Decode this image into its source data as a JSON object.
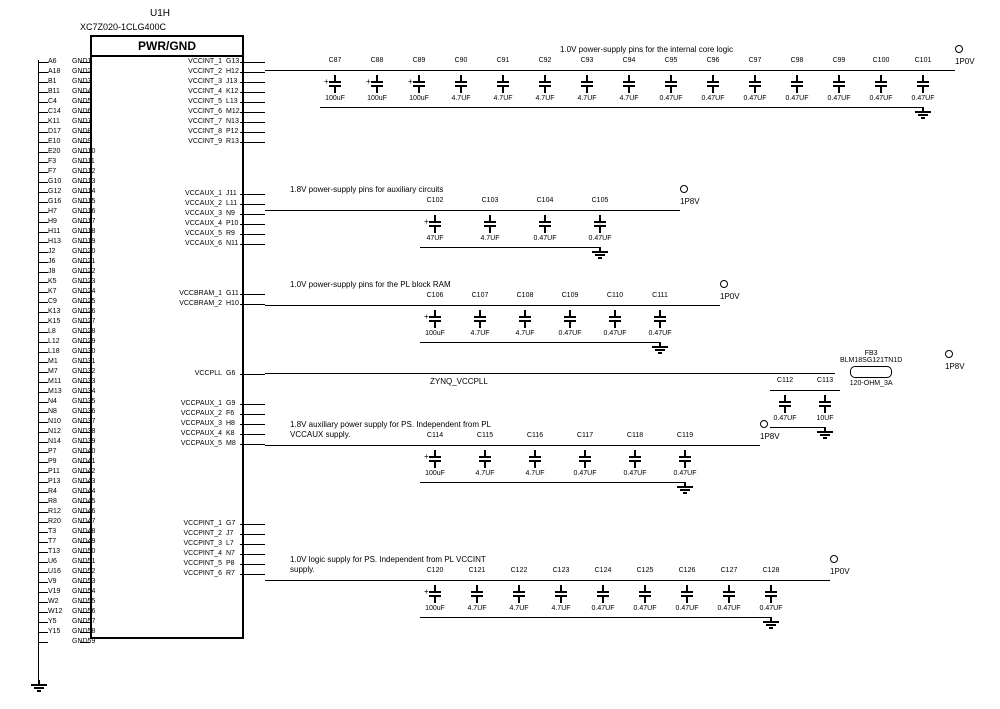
{
  "ref": "U1H",
  "part": "XC7Z020-1CLG400C",
  "block_title": "PWR/GND",
  "rails": {
    "vccint": "1P0V",
    "vccaux": "1P8V",
    "vccbram": "1P0V",
    "vccpaux": "1P8V",
    "vccpint": "1P0V",
    "vccpll": "1P8V"
  },
  "notes": {
    "vccint": "1.0V power-supply pins for the internal core logic",
    "vccaux": "1.8V power-supply pins for auxiliary circuits",
    "vccbram": "1.0V power-supply pins for the PL block RAM",
    "vccpaux1": "1.8V auxiliary power supply for PS. Independent from PL",
    "vccpaux2": "VCCAUX supply.",
    "vccpint1": "1.0V logic supply for PS. Independent from PL VCCINT",
    "vccpint2": "supply.",
    "vccpll_net": "ZYNQ_VCCPLL"
  },
  "ferrite": {
    "ref": "FB3",
    "part": "BLM18SG121TN1D",
    "value": "120-OHM_3A"
  },
  "pll_caps": [
    {
      "ref": "C112",
      "val": "0.47UF"
    },
    {
      "ref": "C113",
      "val": "10UF"
    }
  ],
  "left_pins": [
    {
      "num": "A6",
      "name": "GND1"
    },
    {
      "num": "A18",
      "name": "GND2"
    },
    {
      "num": "B1",
      "name": "GND3"
    },
    {
      "num": "B11",
      "name": "GND4"
    },
    {
      "num": "C4",
      "name": "GND5"
    },
    {
      "num": "C14",
      "name": "GND6"
    },
    {
      "num": "K11",
      "name": "GND7"
    },
    {
      "num": "D17",
      "name": "GND8"
    },
    {
      "num": "E10",
      "name": "GND9"
    },
    {
      "num": "E20",
      "name": "GND10"
    },
    {
      "num": "F3",
      "name": "GND11"
    },
    {
      "num": "F7",
      "name": "GND12"
    },
    {
      "num": "G10",
      "name": "GND13"
    },
    {
      "num": "G12",
      "name": "GND14"
    },
    {
      "num": "G16",
      "name": "GND15"
    },
    {
      "num": "H7",
      "name": "GND16"
    },
    {
      "num": "H9",
      "name": "GND17"
    },
    {
      "num": "H11",
      "name": "GND18"
    },
    {
      "num": "H13",
      "name": "GND19"
    },
    {
      "num": "J2",
      "name": "GND20"
    },
    {
      "num": "J6",
      "name": "GND21"
    },
    {
      "num": "J8",
      "name": "GND22"
    },
    {
      "num": "K5",
      "name": "GND23"
    },
    {
      "num": "K7",
      "name": "GND24"
    },
    {
      "num": "C9",
      "name": "GND25"
    },
    {
      "num": "K13",
      "name": "GND26"
    },
    {
      "num": "K15",
      "name": "GND27"
    },
    {
      "num": "L8",
      "name": "GND28"
    },
    {
      "num": "L12",
      "name": "GND29"
    },
    {
      "num": "L18",
      "name": "GND30"
    },
    {
      "num": "M1",
      "name": "GND31"
    },
    {
      "num": "M7",
      "name": "GND32"
    },
    {
      "num": "M11",
      "name": "GND33"
    },
    {
      "num": "M13",
      "name": "GND34"
    },
    {
      "num": "N4",
      "name": "GND35"
    },
    {
      "num": "N8",
      "name": "GND36"
    },
    {
      "num": "N10",
      "name": "GND37"
    },
    {
      "num": "N12",
      "name": "GND38"
    },
    {
      "num": "N14",
      "name": "GND39"
    },
    {
      "num": "P7",
      "name": "GND40"
    },
    {
      "num": "P9",
      "name": "GND41"
    },
    {
      "num": "P11",
      "name": "GND42"
    },
    {
      "num": "P13",
      "name": "GND43"
    },
    {
      "num": "R4",
      "name": "GND44"
    },
    {
      "num": "R8",
      "name": "GND45"
    },
    {
      "num": "R12",
      "name": "GND46"
    },
    {
      "num": "R20",
      "name": "GND47"
    },
    {
      "num": "T3",
      "name": "GND48"
    },
    {
      "num": "T7",
      "name": "GND49"
    },
    {
      "num": "T13",
      "name": "GND50"
    },
    {
      "num": "U6",
      "name": "GND51"
    },
    {
      "num": "U16",
      "name": "GND52"
    },
    {
      "num": "V9",
      "name": "GND53"
    },
    {
      "num": "V19",
      "name": "GND54"
    },
    {
      "num": "W2",
      "name": "GND55"
    },
    {
      "num": "W12",
      "name": "GND56"
    },
    {
      "num": "Y5",
      "name": "GND57"
    },
    {
      "num": "Y15",
      "name": "GND58"
    },
    {
      "num": "",
      "name": "GND59"
    }
  ],
  "right_groups": [
    {
      "key": "vccint",
      "pins": [
        {
          "name": "VCCINT_1",
          "num": "G13"
        },
        {
          "name": "VCCINT_2",
          "num": "H12"
        },
        {
          "name": "VCCINT_3",
          "num": "J13"
        },
        {
          "name": "VCCINT_4",
          "num": "K12"
        },
        {
          "name": "VCCINT_5",
          "num": "L13"
        },
        {
          "name": "VCCINT_6",
          "num": "M12"
        },
        {
          "name": "VCCINT_7",
          "num": "N13"
        },
        {
          "name": "VCCINT_8",
          "num": "P12"
        },
        {
          "name": "VCCINT_9",
          "num": "R13"
        }
      ]
    },
    {
      "key": "vccaux",
      "pins": [
        {
          "name": "VCCAUX_1",
          "num": "J11"
        },
        {
          "name": "VCCAUX_2",
          "num": "L11"
        },
        {
          "name": "VCCAUX_3",
          "num": "N9"
        },
        {
          "name": "VCCAUX_4",
          "num": "P10"
        },
        {
          "name": "VCCAUX_5",
          "num": "R9"
        },
        {
          "name": "VCCAUX_6",
          "num": "N11"
        }
      ]
    },
    {
      "key": "vccbram",
      "pins": [
        {
          "name": "VCCBRAM_1",
          "num": "G11"
        },
        {
          "name": "VCCBRAM_2",
          "num": "H10"
        }
      ]
    },
    {
      "key": "vccpll",
      "pins": [
        {
          "name": "VCCPLL",
          "num": "G6"
        }
      ]
    },
    {
      "key": "vccpaux",
      "pins": [
        {
          "name": "VCCPAUX_1",
          "num": "G9"
        },
        {
          "name": "VCCPAUX_2",
          "num": "F6"
        },
        {
          "name": "VCCPAUX_3",
          "num": "H8"
        },
        {
          "name": "VCCPAUX_4",
          "num": "K8"
        },
        {
          "name": "VCCPAUX_5",
          "num": "M8"
        }
      ]
    },
    {
      "key": "vccpint",
      "pins": [
        {
          "name": "VCCPINT_1",
          "num": "G7"
        },
        {
          "name": "VCCPINT_2",
          "num": "J7"
        },
        {
          "name": "VCCPINT_3",
          "num": "L7"
        },
        {
          "name": "VCCPINT_4",
          "num": "N7"
        },
        {
          "name": "VCCPINT_5",
          "num": "P8"
        },
        {
          "name": "VCCPINT_6",
          "num": "R7"
        }
      ]
    }
  ],
  "cap_banks": {
    "vccint": [
      {
        "ref": "C87",
        "val": "100uF",
        "pol": true
      },
      {
        "ref": "C88",
        "val": "100uF",
        "pol": true
      },
      {
        "ref": "C89",
        "val": "100uF",
        "pol": true
      },
      {
        "ref": "C90",
        "val": "4.7UF"
      },
      {
        "ref": "C91",
        "val": "4.7UF"
      },
      {
        "ref": "C92",
        "val": "4.7UF"
      },
      {
        "ref": "C93",
        "val": "4.7UF"
      },
      {
        "ref": "C94",
        "val": "4.7UF"
      },
      {
        "ref": "C95",
        "val": "0.47UF"
      },
      {
        "ref": "C96",
        "val": "0.47UF"
      },
      {
        "ref": "C97",
        "val": "0.47UF"
      },
      {
        "ref": "C98",
        "val": "0.47UF"
      },
      {
        "ref": "C99",
        "val": "0.47UF"
      },
      {
        "ref": "C100",
        "val": "0.47UF"
      },
      {
        "ref": "C101",
        "val": "0.47UF"
      }
    ],
    "vccaux": [
      {
        "ref": "C102",
        "val": "47UF",
        "pol": true
      },
      {
        "ref": "C103",
        "val": "4.7UF"
      },
      {
        "ref": "C104",
        "val": "0.47UF"
      },
      {
        "ref": "C105",
        "val": "0.47UF"
      }
    ],
    "vccbram": [
      {
        "ref": "C106",
        "val": "100uF",
        "pol": true
      },
      {
        "ref": "C107",
        "val": "4.7UF"
      },
      {
        "ref": "C108",
        "val": "4.7UF"
      },
      {
        "ref": "C109",
        "val": "0.47UF"
      },
      {
        "ref": "C110",
        "val": "0.47UF"
      },
      {
        "ref": "C111",
        "val": "0.47UF"
      }
    ],
    "vccpaux": [
      {
        "ref": "C114",
        "val": "100uF",
        "pol": true
      },
      {
        "ref": "C115",
        "val": "4.7UF"
      },
      {
        "ref": "C116",
        "val": "4.7UF"
      },
      {
        "ref": "C117",
        "val": "0.47UF"
      },
      {
        "ref": "C118",
        "val": "0.47UF"
      },
      {
        "ref": "C119",
        "val": "0.47UF"
      }
    ],
    "vccpint": [
      {
        "ref": "C120",
        "val": "100uF",
        "pol": true
      },
      {
        "ref": "C121",
        "val": "4.7UF"
      },
      {
        "ref": "C122",
        "val": "4.7UF"
      },
      {
        "ref": "C123",
        "val": "4.7UF"
      },
      {
        "ref": "C124",
        "val": "0.47UF"
      },
      {
        "ref": "C125",
        "val": "0.47UF"
      },
      {
        "ref": "C126",
        "val": "0.47UF"
      },
      {
        "ref": "C127",
        "val": "0.47UF"
      },
      {
        "ref": "C128",
        "val": "0.47UF"
      }
    ]
  }
}
